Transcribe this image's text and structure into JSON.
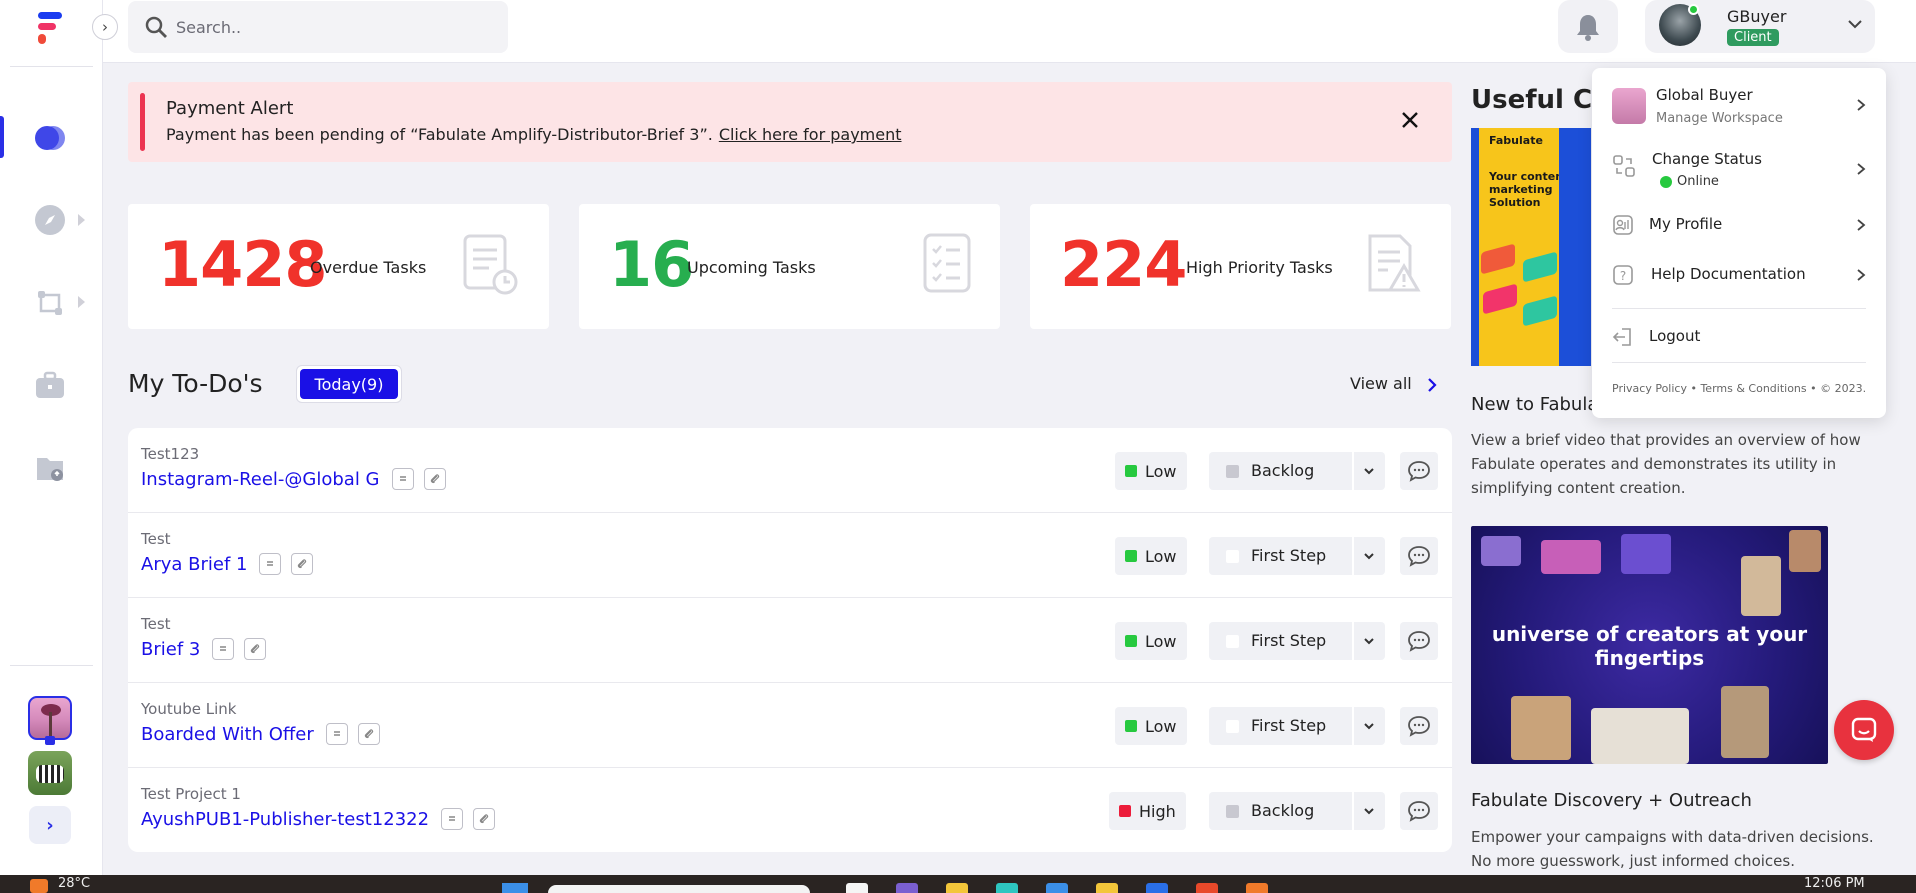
{
  "topbar": {
    "search_placeholder": "Search..",
    "user_name": "GBuyer",
    "user_role": "Client"
  },
  "alert": {
    "title": "Payment Alert",
    "message": "Payment has been pending of “Fabulate Amplify-Distributor-Brief 3”.",
    "link_text": "Click here for payment"
  },
  "stats": [
    {
      "value": "1428",
      "label": "Overdue Tasks",
      "color": "#f0322b"
    },
    {
      "value": "16",
      "label": "Upcoming Tasks",
      "color": "#27ae4f"
    },
    {
      "value": "224",
      "label": "High Priority Tasks",
      "color": "#f0322b"
    }
  ],
  "todos": {
    "title": "My To-Do's",
    "filter_label": "Today(9)",
    "view_all_label": "View all",
    "rows": [
      {
        "project": "Test123",
        "task": "Instagram-Reel-@Global G",
        "priority": "Low",
        "priority_color": "#27c93f",
        "status": "Backlog",
        "status_color": "#c8c8d0"
      },
      {
        "project": "Test",
        "task": "Arya Brief 1",
        "priority": "Low",
        "priority_color": "#27c93f",
        "status": "First Step",
        "status_color": "#ffffff"
      },
      {
        "project": "Test",
        "task": "Brief 3",
        "priority": "Low",
        "priority_color": "#27c93f",
        "status": "First Step",
        "status_color": "#ffffff"
      },
      {
        "project": "Youtube Link",
        "task": "Boarded With Offer",
        "priority": "Low",
        "priority_color": "#27c93f",
        "status": "First Step",
        "status_color": "#ffffff"
      },
      {
        "project": "Test Project 1",
        "task": "AyushPUB1-Publisher-test12322",
        "priority": "High",
        "priority_color": "#ec1c3a",
        "status": "Backlog",
        "status_color": "#c8c8d0"
      }
    ]
  },
  "right_panel": {
    "title": "Useful Co",
    "promo1_brand": "Fabulate",
    "promo1_copy": "Your content marketing Solution",
    "new_to_title": "New to Fabula",
    "new_to_desc": "View a brief video that provides an overview of how Fabulate operates and demonstrates its utility in simplifying content creation.",
    "promo2_headline": "universe of creators at your fingertips",
    "discovery_title": "Fabulate Discovery + Outreach",
    "discovery_desc": "Empower your campaigns with data-driven decisions. No more guesswork, just informed choices."
  },
  "menu": {
    "workspace_name": "Global Buyer",
    "workspace_sub": "Manage Workspace",
    "change_status": "Change Status",
    "status_value": "Online",
    "my_profile": "My Profile",
    "help_docs": "Help Documentation",
    "logout": "Logout",
    "footer": "Privacy Policy • Terms & Conditions • © 2023."
  },
  "taskbar": {
    "weather": "28°C",
    "time": "12:06 PM"
  },
  "colors": {
    "accent": "#1a10e6",
    "alert_bg": "#fde4e6",
    "alert_bar": "#ec3451",
    "client_badge": "#2f9b5f",
    "online": "#27c93f",
    "chat_fab": "#e8323e"
  }
}
